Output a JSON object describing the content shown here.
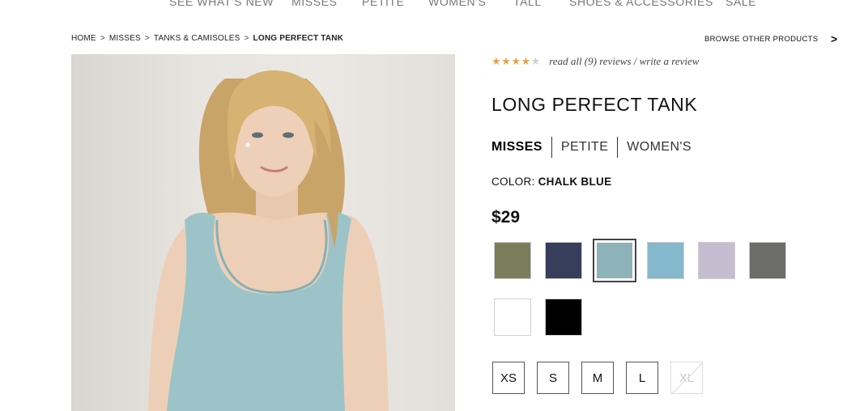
{
  "nav": {
    "items": [
      "SEE WHAT'S NEW",
      "MISSES",
      "PETITE",
      "WOMEN'S",
      "TALL",
      "SHOES & ACCESSORIES",
      "SALE"
    ]
  },
  "breadcrumb": {
    "items": [
      "HOME",
      "MISSES",
      "TANKS & CAMISOLES",
      "LONG PERFECT TANK"
    ],
    "separator": ">"
  },
  "browse": {
    "label": "BROWSE OTHER PRODUCTS",
    "arrow": ">"
  },
  "rating": {
    "stars_filled": 4,
    "stars_total": 5,
    "read_reviews": "read all (9) reviews",
    "divider": "/",
    "write_review": "write a review"
  },
  "product": {
    "title": "LONG PERFECT TANK",
    "fits": [
      "MISSES",
      "PETITE",
      "WOMEN'S"
    ],
    "active_fit": "MISSES",
    "color_prefix": "COLOR:",
    "color_name": "CHALK BLUE",
    "price": "$29"
  },
  "swatches": [
    {
      "name": "olive",
      "hex": "#7b7c5a"
    },
    {
      "name": "navy",
      "hex": "#363e5b"
    },
    {
      "name": "chalk-blue",
      "hex": "#8db2b7",
      "selected": true
    },
    {
      "name": "sky-blue",
      "hex": "#85b8cc"
    },
    {
      "name": "lilac",
      "hex": "#c6bccf"
    },
    {
      "name": "charcoal",
      "hex": "#6c6d68"
    },
    {
      "name": "white",
      "hex": "#ffffff"
    },
    {
      "name": "black",
      "hex": "#000000"
    }
  ],
  "sizes": [
    {
      "label": "XS",
      "available": true
    },
    {
      "label": "S",
      "available": true
    },
    {
      "label": "M",
      "available": true
    },
    {
      "label": "L",
      "available": true
    },
    {
      "label": "XL",
      "available": false
    }
  ],
  "colors": {
    "star": "#e8a04a",
    "tank": "#9cc4c8"
  }
}
